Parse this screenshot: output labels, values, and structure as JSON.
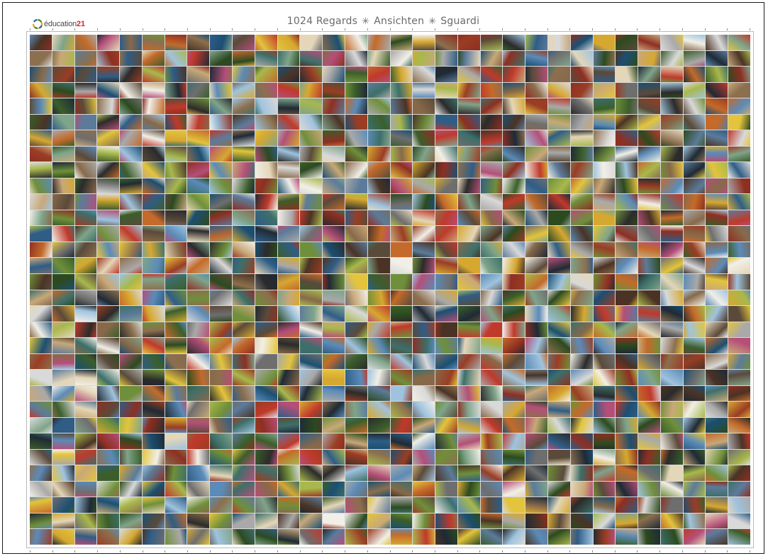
{
  "logo": {
    "text_main": "éducation",
    "text_accent": "21",
    "icon": "education21-logo-icon"
  },
  "title": {
    "part1": "1024 Regards",
    "part2": "Ansichten",
    "part3": "Sguardi",
    "separator_symbol": "✳"
  },
  "mosaic": {
    "rows": 32,
    "cols": 32,
    "tile_count": 1024,
    "palette": [
      "#3b5e2b",
      "#6f8f3a",
      "#a8b84c",
      "#d6a830",
      "#c0392b",
      "#8e2f22",
      "#2f5d86",
      "#5b8bb8",
      "#9fc3de",
      "#1f2a35",
      "#5a4a3a",
      "#8c6f4e",
      "#c8a878",
      "#e4d6b8",
      "#2b2b2b",
      "#6e6e6e",
      "#a9a9a9",
      "#d9d9d9",
      "#3d6f6a",
      "#7fa48a",
      "#b44f78",
      "#e3c43c",
      "#4a3325",
      "#2c4a1f",
      "#87694a",
      "#c46a2a",
      "#f1efe7",
      "#5c7b9a",
      "#1b4f72",
      "#9a3d24"
    ]
  }
}
